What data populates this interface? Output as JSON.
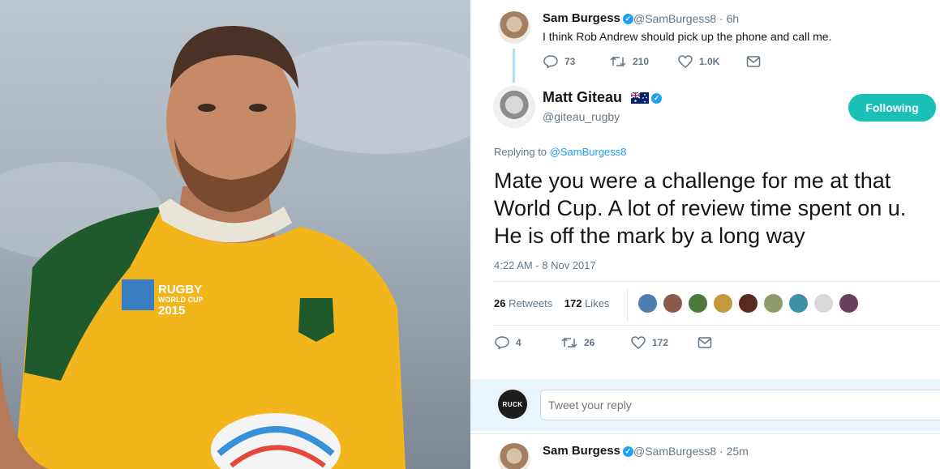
{
  "tweet_top": {
    "name": "Sam Burgess",
    "handle_time": "@SamBurgess8 · 6h",
    "text": "I think Rob Andrew should pick up the phone and call me.",
    "reply_count": "73",
    "retweet_count": "210",
    "like_count": "1.0K"
  },
  "main_tweet": {
    "name": "Matt Giteau",
    "handle": "@giteau_rugby",
    "follow_label": "Following",
    "replying_prefix": "Replying to",
    "replying_to": "@SamBurgess8",
    "text": "Mate you were a challenge for me at that World Cup. A lot of review time spent on u. He is off the mark by a long way",
    "timestamp": "4:22 AM - 8 Nov 2017",
    "retweets_count": "26",
    "retweets_label": "Retweets",
    "likes_count": "172",
    "likes_label": "Likes",
    "reply_count": "4",
    "retweet_count": "26",
    "like_count": "172"
  },
  "reply_composer": {
    "avatar_text": "RUCK",
    "placeholder": "Tweet your reply"
  },
  "tweet_bottom": {
    "name": "Sam Burgess",
    "handle_time": "@SamBurgess8 · 25m"
  },
  "photo": {
    "jersey_badge_line1": "RUGBY",
    "jersey_badge_line2": "WORLD CUP",
    "jersey_badge_line3": "2015"
  },
  "colors": {
    "accent": "#1da1f2",
    "follow_button": "#1ac0b6",
    "jersey_gold": "#f2b51c",
    "jersey_green": "#1f5a2c"
  },
  "icons": [
    "reply-icon",
    "retweet-icon",
    "like-icon",
    "message-icon",
    "verified-icon",
    "australia-flag-icon"
  ]
}
